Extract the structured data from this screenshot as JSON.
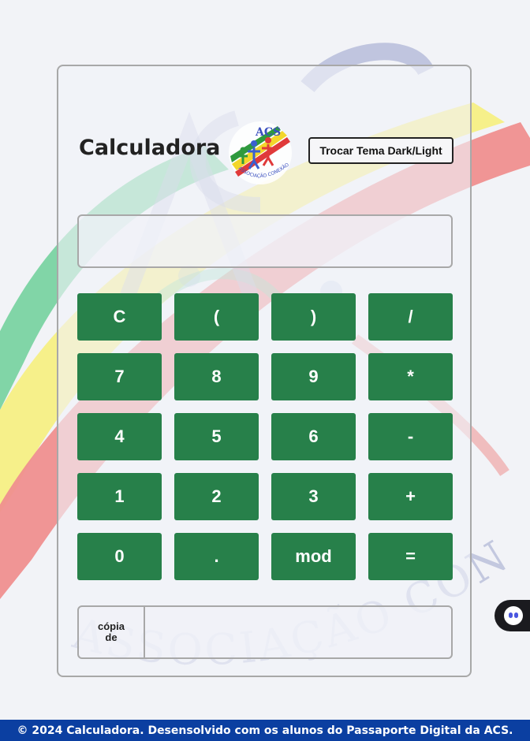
{
  "app": {
    "title": "Calculadora",
    "theme_button_label": "Trocar Tema Dark/Light",
    "logo_name": "acs-logo",
    "logo_text": "ACS",
    "logo_caption": "ASSOCIAÇÃO CONEXÃO SOCIAL"
  },
  "display": {
    "value": ""
  },
  "keypad": {
    "keys": [
      "C",
      "(",
      ")",
      "/",
      "7",
      "8",
      "9",
      "*",
      "4",
      "5",
      "6",
      "-",
      "1",
      "2",
      "3",
      "+",
      "0",
      ".",
      "mod",
      "="
    ]
  },
  "copy": {
    "button_label": "cópia de",
    "value": ""
  },
  "watermark": {
    "text": "ASSOCIAÇÃO CON",
    "letters": "ACS"
  },
  "chat_widget": {
    "icon": "chat-bot-icon"
  },
  "footer": {
    "text": "© 2024 Calculadora. Desensolvido com os alunos do Passaporte Digital da ACS."
  },
  "colors": {
    "key_green": "#27804a",
    "footer_blue": "#0b3fa1",
    "background": "#f2f3f7"
  }
}
